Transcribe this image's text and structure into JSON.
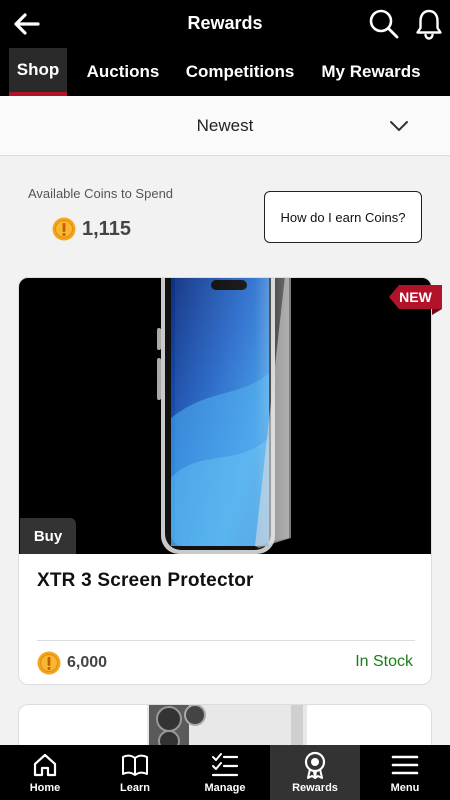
{
  "header": {
    "title": "Rewards",
    "back_icon": "arrow-left-icon",
    "search_icon": "search-icon",
    "notifications_icon": "bell-icon"
  },
  "tabs": [
    {
      "label": "Shop",
      "active": true
    },
    {
      "label": "Auctions",
      "active": false
    },
    {
      "label": "Competitions",
      "active": false
    },
    {
      "label": "My Rewards",
      "active": false
    }
  ],
  "sort": {
    "selected": "Newest",
    "icon": "chevron-down-icon"
  },
  "coins": {
    "label": "Available Coins to Spend",
    "value": "1,115",
    "earn_button": "How do I earn Coins?"
  },
  "products": [
    {
      "name": "XTR 3 Screen Protector",
      "price": "6,000",
      "stock": "In Stock",
      "badge": "NEW",
      "action": "Buy"
    }
  ],
  "bottom_nav": [
    {
      "label": "Home",
      "icon": "home-icon",
      "active": false
    },
    {
      "label": "Learn",
      "icon": "book-icon",
      "active": false
    },
    {
      "label": "Manage",
      "icon": "checklist-icon",
      "active": false
    },
    {
      "label": "Rewards",
      "icon": "award-icon",
      "active": true
    },
    {
      "label": "Menu",
      "icon": "hamburger-icon",
      "active": false
    }
  ],
  "colors": {
    "accent": "#b3122b",
    "coin": "#f4a51c",
    "in_stock": "#1a7f1a",
    "header_bg": "#000000"
  }
}
